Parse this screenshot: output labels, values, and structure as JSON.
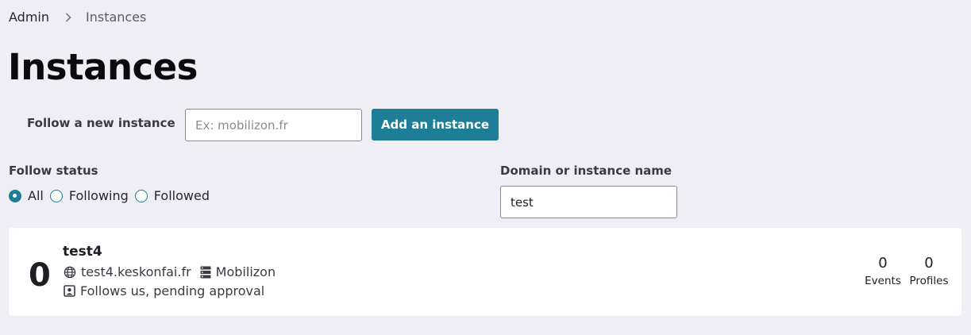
{
  "breadcrumb": {
    "parent": "Admin",
    "current": "Instances"
  },
  "page_title": "Instances",
  "follow": {
    "label": "Follow a new instance",
    "placeholder": "Ex: mobilizon.fr",
    "button": "Add an instance"
  },
  "filters": {
    "status_label": "Follow status",
    "options": [
      "All",
      "Following",
      "Followed"
    ],
    "selected": "All",
    "domain_label": "Domain or instance name",
    "domain_value": "test"
  },
  "instances": [
    {
      "count": "0",
      "name": "test4",
      "domain": "test4.keskonfai.fr",
      "software": "Mobilizon",
      "follow_status": "Follows us, pending approval",
      "events_count": "0",
      "events_label": "Events",
      "profiles_count": "0",
      "profiles_label": "Profiles"
    }
  ],
  "icons": {
    "breadcrumb_sep": "chevron-right-icon",
    "domain": "globe-icon",
    "software": "server-icon",
    "follow_status": "account-pending-icon"
  },
  "colors": {
    "accent": "#1e7d97",
    "background": "#efeef4"
  }
}
